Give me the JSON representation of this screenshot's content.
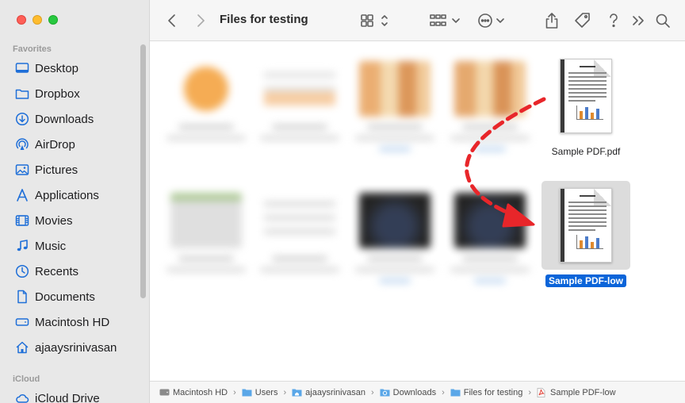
{
  "window": {
    "title": "Files for testing"
  },
  "sidebar": {
    "favorites_title": "Favorites",
    "icloud_title": "iCloud",
    "items": [
      {
        "label": "Desktop",
        "icon": "desktop-icon"
      },
      {
        "label": "Dropbox",
        "icon": "folder-icon"
      },
      {
        "label": "Downloads",
        "icon": "downloads-icon"
      },
      {
        "label": "AirDrop",
        "icon": "airdrop-icon"
      },
      {
        "label": "Pictures",
        "icon": "pictures-icon"
      },
      {
        "label": "Applications",
        "icon": "applications-icon"
      },
      {
        "label": "Movies",
        "icon": "movies-icon"
      },
      {
        "label": "Music",
        "icon": "music-icon"
      },
      {
        "label": "Recents",
        "icon": "recents-icon"
      },
      {
        "label": "Documents",
        "icon": "documents-icon"
      },
      {
        "label": "Macintosh HD",
        "icon": "hard-drive-icon"
      },
      {
        "label": "ajaaysrinivasan",
        "icon": "home-icon"
      }
    ],
    "icloud_items": [
      {
        "label": "iCloud Drive",
        "icon": "icloud-icon"
      }
    ]
  },
  "files": [
    {
      "name": "Sample PDF.pdf",
      "selected": false
    },
    {
      "name": "Sample PDF-low",
      "selected": true
    }
  ],
  "pathbar": [
    {
      "label": "Macintosh HD",
      "icon": "hard-drive-icon"
    },
    {
      "label": "Users",
      "icon": "folder-icon"
    },
    {
      "label": "ajaaysrinivasan",
      "icon": "home-folder-icon"
    },
    {
      "label": "Downloads",
      "icon": "downloads-folder-icon"
    },
    {
      "label": "Files for testing",
      "icon": "folder-icon"
    },
    {
      "label": "Sample PDF-low",
      "icon": "pdf-file-icon"
    }
  ],
  "colors": {
    "accent": "#0a64d9",
    "sidebar_icon": "#1f6fd8",
    "arrow": "#e8262a",
    "sidebar_bg": "#e8e8e8"
  }
}
